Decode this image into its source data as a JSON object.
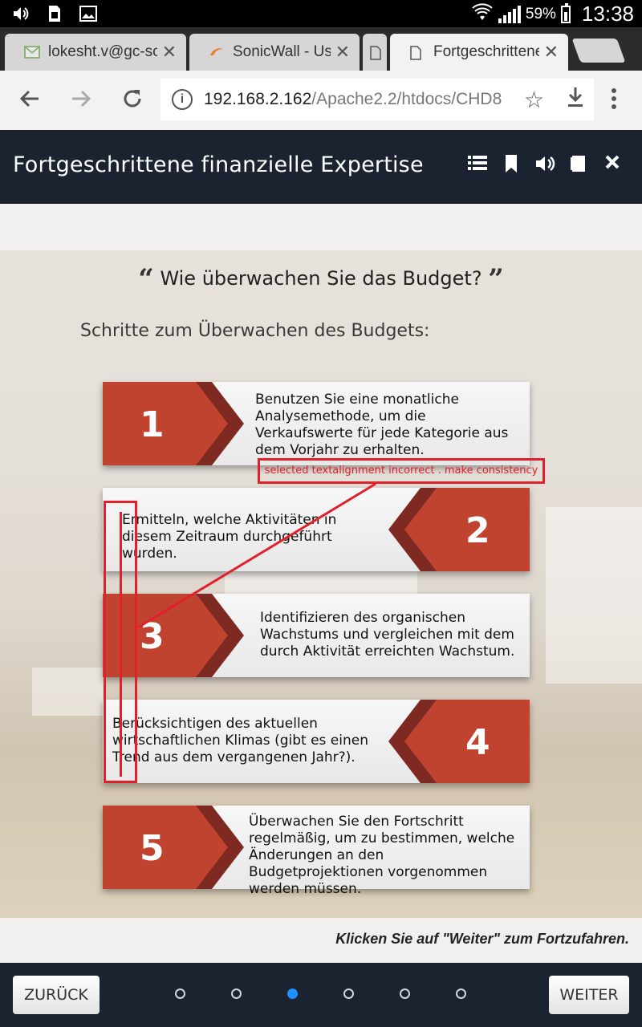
{
  "status_bar": {
    "battery": "59%",
    "time": "13:38",
    "icons": [
      "volume-icon",
      "sim-icon",
      "image-icon",
      "wifi-icon",
      "signal-icon",
      "battery-icon"
    ]
  },
  "browser": {
    "tabs": [
      {
        "label": "lokesht.v@gc-sc",
        "icon": "mail-icon"
      },
      {
        "label": "SonicWall - User",
        "icon": "sonicwall-icon"
      },
      {
        "label": "",
        "icon": "page-icon"
      },
      {
        "label": "Fortgeschrittene",
        "icon": "page-icon",
        "active": true
      }
    ],
    "url_host": "192.168.2.162",
    "url_path": "/Apache2.2/htdocs/CHD8"
  },
  "course": {
    "title": "Fortgeschrittene finanzielle Expertise",
    "header_icons": [
      "menu-list-icon",
      "bookmark-icon",
      "audio-icon",
      "notes-icon",
      "close-icon"
    ]
  },
  "slide": {
    "question": "Wie überwachen Sie das Budget?",
    "subtitle": "Schritte zum Überwachen des Budgets:",
    "steps": [
      {
        "num": "1",
        "text": "Benutzen Sie eine monatliche Analysemethode, um die Verkaufswerte für jede Kategorie aus dem Vorjahr zu erhalten."
      },
      {
        "num": "2",
        "text": "Ermitteln, welche Aktivitäten in diesem Zeitraum durchgeführt wurden."
      },
      {
        "num": "3",
        "text": "Identifizieren des organischen Wachstums und vergleichen mit dem durch Aktivität erreichten Wachstum."
      },
      {
        "num": "4",
        "text": "Berücksichtigen des aktuellen wirtschaftlichen Klimas (gibt es einen Trend aus dem vergangenen Jahr?)."
      },
      {
        "num": "5",
        "text": "Überwachen Sie den Fortschritt regelmäßig, um zu bestimmen, welche Änderungen an den Budgetprojektionen vorgenommen werden müssen."
      }
    ],
    "annotation": "selected textalignment incorrect . make consistency",
    "continue_hint": "Klicken Sie auf \"Weiter\" zum Fortzufahren."
  },
  "navigation": {
    "back": "ZURÜCK",
    "next": "WEITER",
    "page_count": 6,
    "current_page": 3
  },
  "colors": {
    "header_bg": "#1b2330",
    "badge_red": "#c0392b",
    "annotation_red": "#e0202a",
    "active_dot": "#1e90ff"
  }
}
